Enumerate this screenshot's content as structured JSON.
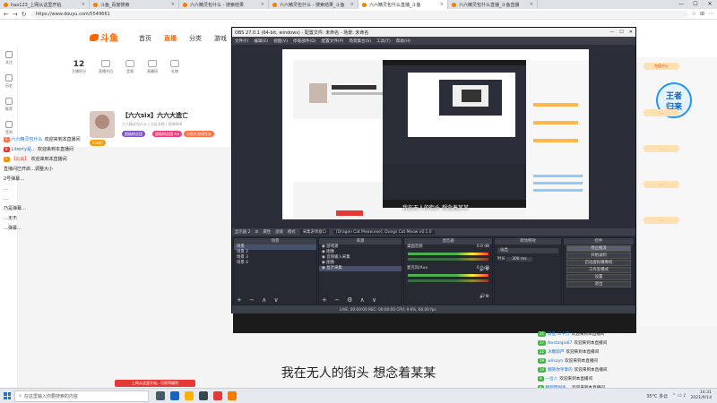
{
  "browser": {
    "tabs": [
      {
        "label": "hao123_上网从这里开始"
      },
      {
        "label": "斗鱼_百度搜索"
      },
      {
        "label": "六六精灵包什么 - 搜索结果"
      },
      {
        "label": "六六精灵包什么 - 搜索结果_斗鱼"
      },
      {
        "label": "六六精灵包什么直播_斗鱼"
      },
      {
        "label": "六六精灵包什么直播_斗鱼直播"
      }
    ],
    "url": "https://www.douyu.com/5549661",
    "window_controls": {
      "min": "—",
      "max": "☐",
      "close": "✕"
    }
  },
  "douyu": {
    "logo": "斗鱼",
    "nav": [
      {
        "label": "首页"
      },
      {
        "label": "直播"
      },
      {
        "label": "分类"
      },
      {
        "label": "游戏"
      }
    ],
    "left_rail": [
      {
        "label": "关注"
      },
      {
        "label": "历史"
      },
      {
        "label": "推荐"
      },
      {
        "label": "签到"
      }
    ],
    "stats": [
      {
        "value": "12",
        "label": "主播积分"
      },
      {
        "value": "",
        "label": "直播节目"
      },
      {
        "value": "",
        "label": "音频"
      },
      {
        "value": "",
        "label": "直播间"
      },
      {
        "value": "",
        "label": "礼物"
      }
    ],
    "room": {
      "title": "【六六six】六六大造亡",
      "info": "六六精灵包什么 | 分区名称 | 668668",
      "level": "V18粉",
      "badges": [
        {
          "label": "超级粉丝团"
        },
        {
          "label": "超级粉丝团 4★"
        },
        {
          "label": "小鱼丸完成任务"
        }
      ],
      "host_name": "六六·小"
    },
    "chat": [
      {
        "level": "6",
        "name": "六六精灵包什么",
        "text": "欢迎来到本直播间"
      },
      {
        "level": "8",
        "name": "Liberty是…",
        "text": "欢迎来到本直播间"
      },
      {
        "level": "4",
        "name": "【公会】",
        "text": "欢迎来到本直播间"
      },
      {
        "level": "",
        "name": "",
        "text": "直播间已开启…调整大小"
      },
      {
        "level": "",
        "name": "",
        "text": "2号弹幕…"
      },
      {
        "level": "",
        "name": "",
        "text": "…"
      },
      {
        "level": "",
        "name": "",
        "text": "…"
      },
      {
        "level": "",
        "name": "",
        "text": "乃是弹幕…"
      },
      {
        "level": "",
        "name": "",
        "text": "…无不"
      },
      {
        "level": "",
        "name": "",
        "text": "…弹幕…"
      }
    ],
    "side_buttons": [
      {
        "label": "充值中心"
      },
      {
        "label": "…"
      },
      {
        "label": "…"
      },
      {
        "label": "…"
      },
      {
        "label": "…"
      }
    ],
    "promo": "王者\n归来",
    "bottom_chat": [
      {
        "level": "21",
        "name": "影乱:三十万",
        "text": "欢迎来到本直播间"
      },
      {
        "level": "17",
        "name": "Nostalgia67",
        "text": "欢迎来到本直播间"
      },
      {
        "level": "22",
        "name": "冰糖葫芦",
        "text": "欢迎来到本直播间"
      },
      {
        "level": "19",
        "name": "wilsayn",
        "text": "欢迎来到本直播间"
      },
      {
        "level": "14",
        "name": "翻到你手掌的",
        "text": "欢迎来到本直播间"
      },
      {
        "level": "9",
        "name": "一位人",
        "text": "欢迎来到本直播间"
      },
      {
        "level": "8",
        "name": "翻到梦想手…",
        "text": "欢迎来到本直播间"
      }
    ],
    "subtitle": "我在无人的街头 想念着某某",
    "toast": "上网从这里开始，可获得福利"
  },
  "obs": {
    "title": "OBS 27.0.1 (64-bit, windows) - 配置文件: 未命名 - 场景: 未命名",
    "menu": [
      {
        "label": "文件(F)"
      },
      {
        "label": "编辑(E)"
      },
      {
        "label": "视图(V)"
      },
      {
        "label": "停靠部件(D)"
      },
      {
        "label": "配置文件(P)"
      },
      {
        "label": "场景集合(S)"
      },
      {
        "label": "工具(T)"
      },
      {
        "label": "帮助(H)"
      }
    ],
    "preview_caption": "我在无人的街头 想念着某某",
    "status_row": {
      "source": "显示器 2",
      "props": "属性",
      "filters": "滤镜",
      "mode": "模式",
      "mode_value": "采集游戏窗口",
      "window_value": "[Dragon Cat Meow.exe]: Dungs Cat Meow v0.1.0"
    },
    "docks": {
      "scenes": {
        "header": "场景",
        "items": [
          {
            "label": "场景"
          },
          {
            "label": "场景 2"
          },
          {
            "label": "场景 3"
          },
          {
            "label": "场景 4"
          }
        ]
      },
      "sources": {
        "header": "来源",
        "items": [
          {
            "label": "游戏源"
          },
          {
            "label": "图像"
          },
          {
            "label": "音频输入采集"
          },
          {
            "label": "图像"
          },
          {
            "label": "显示采集"
          }
        ]
      },
      "mixer": {
        "header": "混音器",
        "tracks": [
          {
            "label": "桌面音频",
            "db": "0.0 dB"
          },
          {
            "label": "麦克风/Aux",
            "db": "0.0 dB"
          }
        ]
      },
      "transitions": {
        "header": "转场特效",
        "type": "淡出",
        "duration_label": "时长",
        "duration": "300 ms"
      },
      "controls": {
        "header": "控件",
        "buttons": [
          {
            "label": "停止推流"
          },
          {
            "label": "开始录制"
          },
          {
            "label": "启动虚拟摄像机"
          },
          {
            "label": "工作室模式"
          },
          {
            "label": "设置"
          },
          {
            "label": "退出"
          }
        ]
      }
    },
    "footer": "LIVE: 00:00:00  REC: 00:00:00  CPU: 9.6%, 60.00 fps"
  },
  "taskbar": {
    "search_placeholder": "在这里输入你要搜索的内容",
    "weather": "35°C 多云",
    "time": "14:31",
    "date": "2021/9/14"
  },
  "colors": {
    "brand": "#ff6600",
    "obs_bg": "#2b2e38",
    "obs_panel": "#3c404b"
  }
}
